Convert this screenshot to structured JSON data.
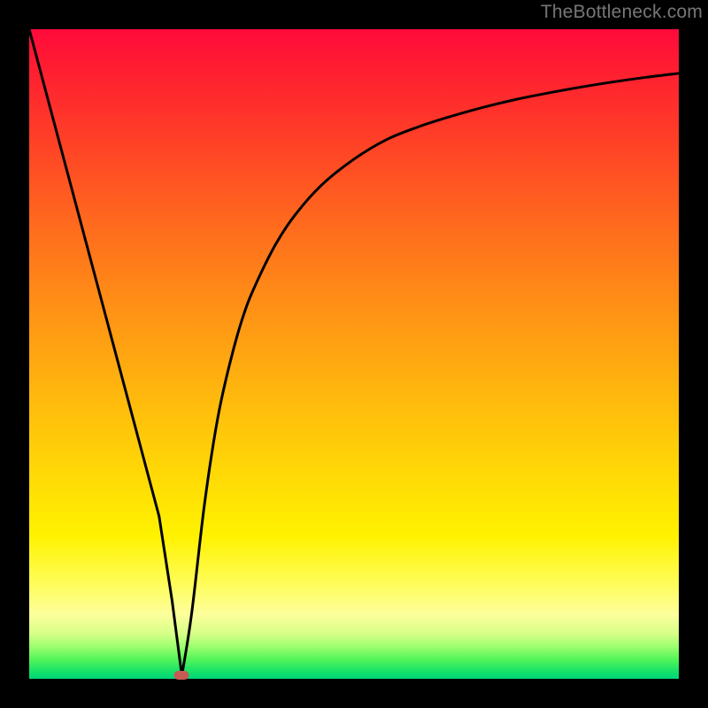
{
  "watermark": "TheBottleneck.com",
  "chart_data": {
    "type": "line",
    "title": "",
    "xlabel": "",
    "ylabel": "",
    "xlim": [
      0,
      100
    ],
    "ylim": [
      0,
      100
    ],
    "grid": false,
    "legend": false,
    "series": [
      {
        "name": "curve",
        "x": [
          0,
          2,
          4,
          6,
          8,
          10,
          12,
          14,
          16,
          18,
          20,
          22,
          23.5,
          25,
          27,
          29,
          31,
          33,
          35,
          38,
          41,
          45,
          50,
          55,
          60,
          65,
          70,
          75,
          80,
          85,
          90,
          95,
          100
        ],
        "y": [
          100,
          92.5,
          85,
          77.5,
          70,
          62.5,
          55,
          47.5,
          40,
          32.5,
          25,
          12,
          0.5,
          10,
          27,
          40,
          49,
          56,
          61,
          67,
          71.5,
          76,
          80,
          83,
          85,
          86.6,
          88,
          89.2,
          90.2,
          91.1,
          91.9,
          92.6,
          93.2
        ]
      }
    ],
    "vertex": {
      "x": 23.5,
      "y": 0.5
    },
    "marker": {
      "x": 23.5,
      "y": 0.5,
      "color": "#c65a55"
    },
    "background_gradient": {
      "orientation": "vertical",
      "stops": [
        {
          "pos": 0,
          "color": "#ff0a3c"
        },
        {
          "pos": 30,
          "color": "#ff6a1e"
        },
        {
          "pos": 60,
          "color": "#ffc60a"
        },
        {
          "pos": 80,
          "color": "#fff200"
        },
        {
          "pos": 92,
          "color": "#fcff90"
        },
        {
          "pos": 100,
          "color": "#00d47a"
        }
      ]
    }
  }
}
